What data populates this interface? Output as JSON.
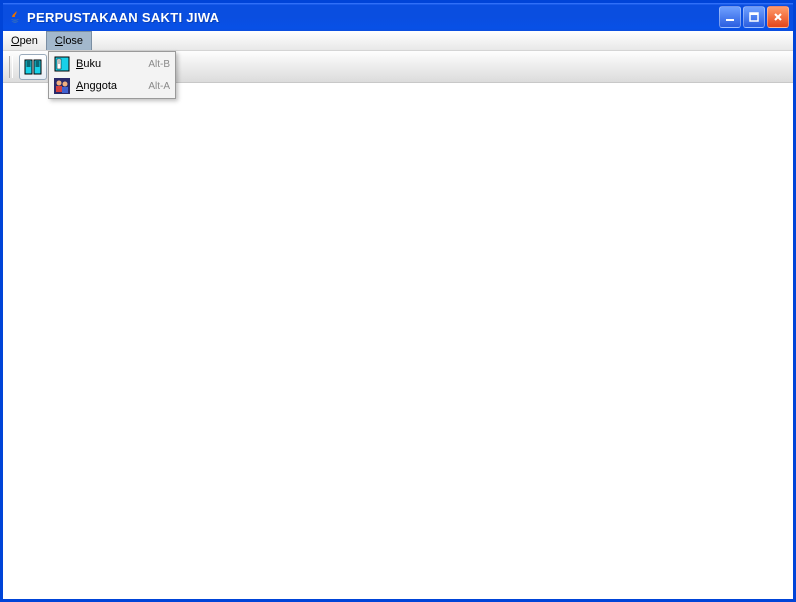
{
  "window": {
    "title": "PERPUSTAKAAN SAKTI JIWA"
  },
  "menubar": {
    "open": "Open",
    "close": "Close"
  },
  "dropdown": {
    "items": [
      {
        "label_prefix": "B",
        "label_rest": "uku",
        "shortcut": "Alt-B",
        "icon": "book-icon"
      },
      {
        "label_prefix": "A",
        "label_rest": "nggota",
        "shortcut": "Alt-A",
        "icon": "member-icon"
      }
    ]
  },
  "icons": {
    "java": "java-icon",
    "minimize": "minimize-icon",
    "maximize": "maximize-icon",
    "close_window": "close-window-icon",
    "toolbar_book": "book-columns-icon"
  }
}
